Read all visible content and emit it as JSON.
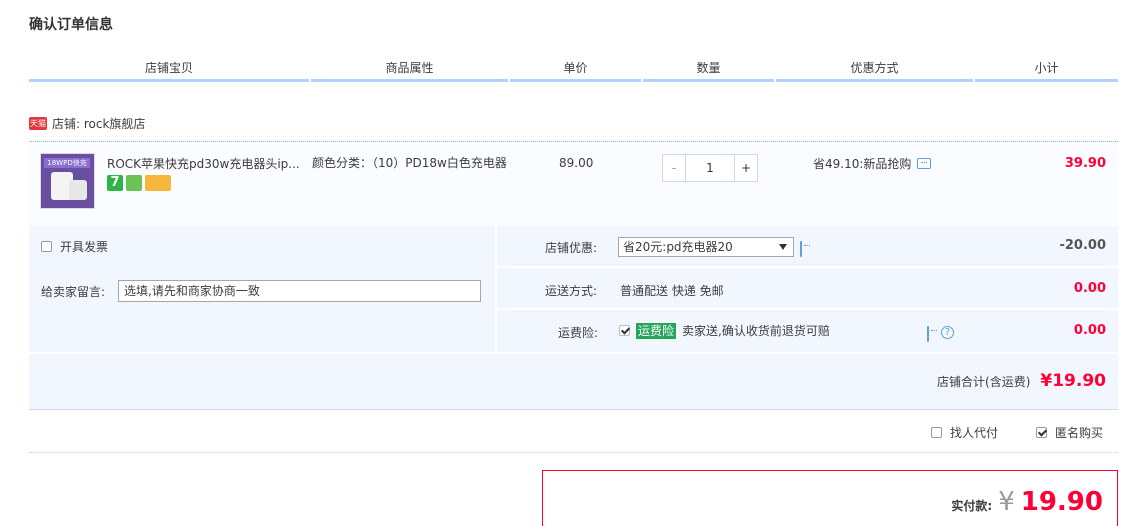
{
  "page_title": "确认订单信息",
  "columns": [
    "店铺宝贝",
    "商品属性",
    "单价",
    "数量",
    "优惠方式",
    "小计"
  ],
  "shop": {
    "badge": "天猫",
    "label": "店铺: rock旗舰店"
  },
  "item": {
    "thumb_text": "18WPD快充",
    "title": "ROCK苹果快充pd30w充电器头ip...",
    "icons": [
      "seven-day-return-icon",
      "guarantee-icon",
      "credit-card-icon"
    ],
    "property": "颜色分类：（10）PD18w白色充电器",
    "price": "89.00",
    "quantity": "1",
    "minus": "-",
    "plus": "+",
    "discount": "省49.10:新品抢购",
    "subtotal": "39.90"
  },
  "invoice": {
    "label": "开具发票",
    "checked": false
  },
  "message": {
    "label": "给卖家留言:",
    "placeholder": "选填,请先和商家协商一致"
  },
  "shop_discount": {
    "label": "店铺优惠:",
    "selected": "省20元:pd充电器20",
    "amount": "-20.00"
  },
  "shipping": {
    "label": "运送方式:",
    "value": "普通配送 快递 免邮",
    "amount": "0.00"
  },
  "insurance": {
    "label": "运费险:",
    "badge": "运费险",
    "text": "卖家送,确认收货前退货可赔",
    "checked": true,
    "amount": "0.00"
  },
  "shop_total": {
    "label": "店铺合计(含运费)",
    "amount": "¥19.90"
  },
  "options": {
    "proxy": {
      "label": "找人代付",
      "checked": false
    },
    "anonymous": {
      "label": "匿名购买",
      "checked": true
    }
  },
  "final": {
    "label": "实付款:",
    "currency": "¥",
    "amount": "19.90"
  },
  "colors": {
    "accent_red": "#ff0036",
    "header_underline": "#b2d1ff",
    "panel_bg": "#f2f7ff",
    "insurance_green": "#26a65b"
  }
}
